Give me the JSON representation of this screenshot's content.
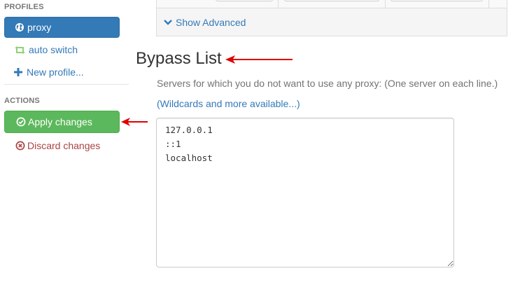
{
  "sidebar": {
    "profiles_header": "PROFILES",
    "items": [
      {
        "label": "proxy",
        "icon": "globe-icon",
        "active": true
      },
      {
        "label": "auto switch",
        "icon": "retweet-icon",
        "active": false
      },
      {
        "label": "New profile...",
        "icon": "plus-icon",
        "active": false
      }
    ],
    "actions_header": "ACTIONS",
    "apply_label": "Apply changes",
    "discard_label": "Discard changes"
  },
  "advanced": {
    "toggle_label": "Show Advanced"
  },
  "bypass": {
    "title": "Bypass List",
    "help_text": "Servers for which you do not want to use any proxy: (One server on each line.)",
    "help_link": "(Wildcards and more available...)",
    "value": "127.0.0.1\n::1\nlocalhost"
  },
  "colors": {
    "primary": "#337ab7",
    "success": "#5cb85c",
    "danger": "#a94442",
    "auto_switch_icon": "#8fd175",
    "annotation_arrow": "#e00000"
  }
}
